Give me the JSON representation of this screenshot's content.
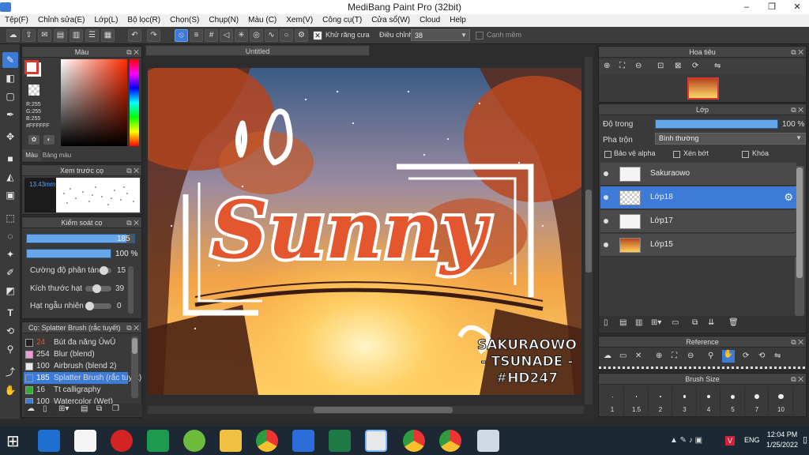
{
  "window": {
    "title": "MediBang Paint Pro (32bit)",
    "controls": [
      "–",
      "❐",
      "✕"
    ]
  },
  "menu": [
    "Tệp(F)",
    "Chỉnh sửa(E)",
    "Lớp(L)",
    "Bộ lọc(R)",
    "Chọn(S)",
    "Chụp(N)",
    "Màu (C)",
    "Xem(V)",
    "Công cụ(T)",
    "Cửa sổ(W)",
    "Cloud",
    "Help"
  ],
  "toolbar": {
    "antialias_label": "Khử răng cưa",
    "adjust_label": "Điều chỉnh",
    "adjust_value": "38",
    "smooth_label": "Cạnh mềm"
  },
  "color_panel": {
    "title": "Màu",
    "r": "R:255",
    "g": "G:255",
    "b": "B:255",
    "hex": "#FFFFFF",
    "tab_color": "Màu",
    "tab_palette": "Bảng màu",
    "fg": "#d83a2f",
    "bg": "#ffffff"
  },
  "preview_panel": {
    "title": "Xem trước cọ",
    "size": "13.43mm"
  },
  "brush_control": {
    "title": "Kiểm soát cọ",
    "size_value": "185",
    "opacity_value": "100 %",
    "scatter_label": "Cường độ phân tán",
    "scatter_value": "15",
    "grain_label": "Kích thước hạt",
    "grain_value": "39",
    "random_label": "Hạt ngẫu nhiên",
    "random_value": "0",
    "size_fill": 0.93,
    "opacity_fill": 1.0,
    "scatter_level": 0.15,
    "grain_level": 0.39,
    "random_level": 0.0
  },
  "brush_list": {
    "title": "Cọ: Splatter Brush (rắc tuyết)",
    "items": [
      {
        "num": "24",
        "name": "Bút đa năng ŪwŪ",
        "color": "#222222",
        "num_color": "#e0562c"
      },
      {
        "num": "254",
        "name": "Blur (blend)",
        "color": "#f09bd8",
        "num_color": "#dddddd"
      },
      {
        "num": "100",
        "name": "Airbrush (blend 2)",
        "color": "#e8e8e8",
        "num_color": "#dddddd"
      },
      {
        "num": "185",
        "name": "Splatter Brush (rắc tuyết)",
        "color": "#3d7bd9",
        "num_color": "#ffffff"
      },
      {
        "num": "16",
        "name": "Tt calligraphy",
        "color": "#2cb22c",
        "num_color": "#dddddd"
      },
      {
        "num": "100",
        "name": "Watercolor (Wet)",
        "color": "#3d7bd9",
        "num_color": "#dddddd"
      }
    ]
  },
  "document": {
    "tab": "Untitled",
    "title_text": "Sunny",
    "stamp_lines": [
      "SAKURAOWO",
      "- TSUNADE -",
      "#HD247"
    ]
  },
  "navigator": {
    "title": "Hoa tiêu"
  },
  "layer_panel": {
    "title": "Lớp",
    "opacity_label": "Độ trong",
    "opacity_value": "100 %",
    "blend_label": "Pha trộn",
    "blend_value": "Bình thường",
    "protect_alpha": "Bảo vệ alpha",
    "clipping": "Xén bớt",
    "lock": "Khóa",
    "layers": [
      "Sakuraowo",
      "Lớp18",
      "Lớp17",
      "Lớp15"
    ]
  },
  "reference": {
    "title": "Reference"
  },
  "brush_size": {
    "title": "Brush Size",
    "sizes": [
      "1",
      "1.5",
      "2",
      "3",
      "4",
      "5",
      "7",
      "10"
    ]
  },
  "taskbar": {
    "time": "12:04 PM",
    "date": "1/25/2022",
    "lang": "ENG"
  }
}
